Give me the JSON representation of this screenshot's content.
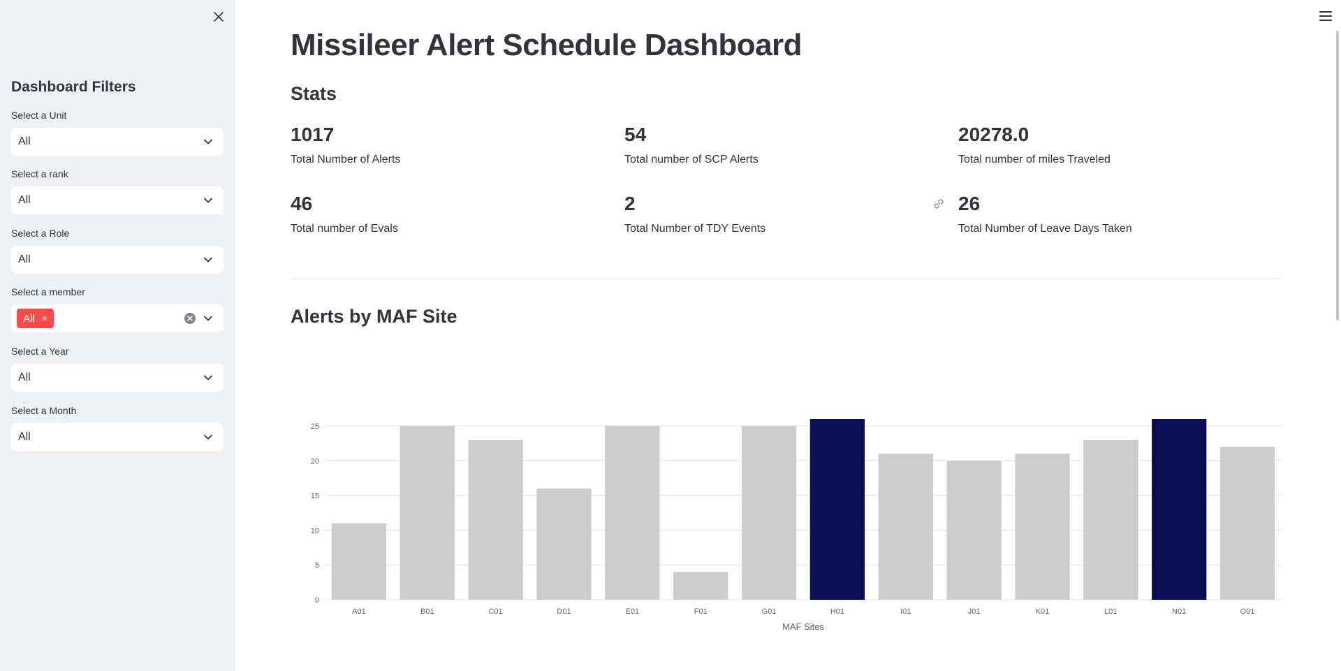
{
  "sidebar": {
    "title": "Dashboard Filters",
    "filters": [
      {
        "label": "Select a Unit",
        "value": "All"
      },
      {
        "label": "Select a rank",
        "value": "All"
      },
      {
        "label": "Select a Role",
        "value": "All"
      },
      {
        "label": "Select a member",
        "tag": "All",
        "tag_close": "×"
      },
      {
        "label": "Select a Year",
        "value": "All"
      },
      {
        "label": "Select a Month",
        "value": "All"
      }
    ]
  },
  "main": {
    "title": "Missileer Alert Schedule Dashboard",
    "stats_heading": "Stats",
    "metrics": [
      {
        "value": "1017",
        "label": "Total Number of Alerts"
      },
      {
        "value": "54",
        "label": "Total number of SCP Alerts"
      },
      {
        "value": "20278.0",
        "label": "Total number of miles Traveled"
      },
      {
        "value": "46",
        "label": "Total number of Evals"
      },
      {
        "value": "2",
        "label": "Total Number of TDY Events"
      },
      {
        "value": "26",
        "label": "Total Number of Leave Days Taken"
      }
    ],
    "chart_heading": "Alerts by MAF Site"
  },
  "colors": {
    "accent": "#ff4b4b",
    "bar_default": "#cccccc",
    "bar_highlight": "#0a0f55",
    "sidebar_bg": "#eef1f6"
  },
  "chart_data": {
    "type": "bar",
    "categories": [
      "A01",
      "B01",
      "C01",
      "D01",
      "E01",
      "F01",
      "G01",
      "H01",
      "I01",
      "J01",
      "K01",
      "L01",
      "N01",
      "O01"
    ],
    "values": [
      11,
      25,
      23,
      16,
      25,
      4,
      25,
      26,
      21,
      20,
      21,
      23,
      26,
      22
    ],
    "highlighted": [
      "H01",
      "N01"
    ],
    "title": "",
    "xlabel": "MAF Sites",
    "ylabel": "",
    "ylim": [
      0,
      26
    ],
    "yticks": [
      0,
      5,
      10,
      15,
      20,
      25
    ],
    "grid": true
  }
}
